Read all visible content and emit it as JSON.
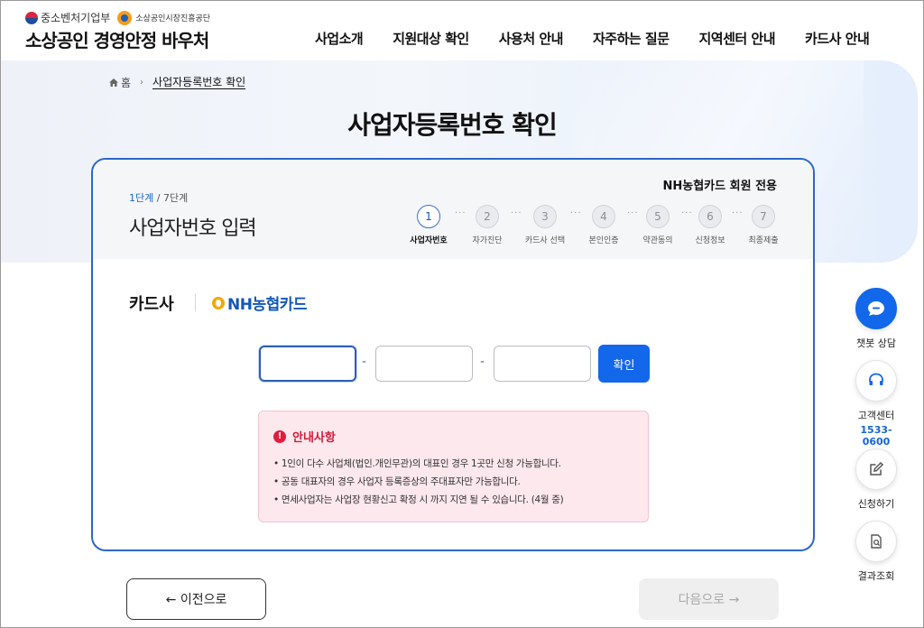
{
  "header": {
    "gov_name": "중소벤처기업부",
    "agency_name": "소상공인시장진흥공단",
    "site_title": "소상공인 경영안정 바우처",
    "nav": [
      "사업소개",
      "지원대상 확인",
      "사용처 안내",
      "자주하는 질문",
      "지역센터 안내",
      "카드사 안내"
    ]
  },
  "breadcrumb": {
    "home": "홈",
    "current": "사업자등록번호 확인"
  },
  "page_title": "사업자등록번호 확인",
  "card": {
    "member_only": "NH농협카드 회원 전용",
    "step_now": "1단계",
    "step_total": " / 7단계",
    "step_title": "사업자번호 입력",
    "steps": [
      {
        "num": "1",
        "label": "사업자번호",
        "active": true
      },
      {
        "num": "2",
        "label": "자가진단",
        "active": false
      },
      {
        "num": "3",
        "label": "카드사 선택",
        "active": false
      },
      {
        "num": "4",
        "label": "본인인증",
        "active": false
      },
      {
        "num": "5",
        "label": "약관동의",
        "active": false
      },
      {
        "num": "6",
        "label": "신청정보",
        "active": false
      },
      {
        "num": "7",
        "label": "최종제출",
        "active": false
      }
    ],
    "dots": "···",
    "card_company_label": "카드사",
    "card_company_name": "NH농협카드",
    "inputs": [
      {
        "value": ""
      },
      {
        "value": ""
      },
      {
        "value": ""
      }
    ],
    "dash": "-",
    "confirm_label": "확인",
    "notice": {
      "title": "안내사항",
      "items": [
        "• 1인이 다수 사업체(법인.개인무관)의 대표인 경우 1곳만 신청 가능합니다.",
        "• 공동 대표자의 경우 사업자 등록증상의 주대표자만 가능합니다.",
        "• 면세사업자는 사업장 현황신고 확정 시 까지 지연 될 수 있습니다. (4월 중)"
      ]
    }
  },
  "buttons": {
    "prev": "← 이전으로",
    "next": "다음으로 →"
  },
  "rail": {
    "chatbot": "챗봇 상담",
    "call_center": "고객센터",
    "phone": "1533-0600",
    "apply": "신청하기",
    "result": "결과조회"
  },
  "colors": {
    "primary": "#1367ea",
    "notice_bg": "#fde8ee",
    "notice_title": "#d21a3a"
  }
}
